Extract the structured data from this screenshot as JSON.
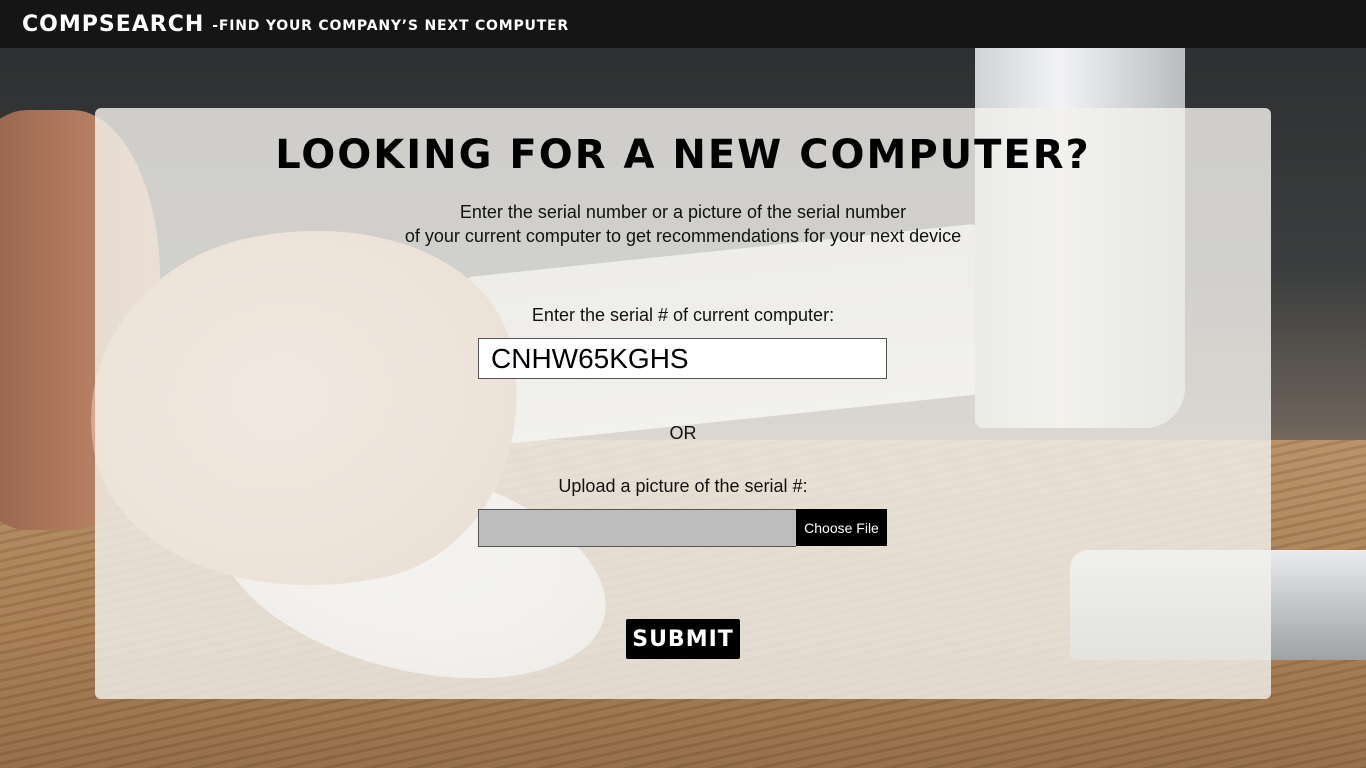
{
  "header": {
    "brand": "COMPSEARCH",
    "tagline": "-FIND YOUR COMPANY’S NEXT COMPUTER"
  },
  "main": {
    "headline": "LOOKING FOR A NEW COMPUTER?",
    "intro_line1": "Enter the serial number or a picture of the serial number",
    "intro_line2": "of your current computer to get recommendations for your next device",
    "serial_label": "Enter the serial # of current computer:",
    "serial_value": "CNHW65KGHS",
    "or_text": "OR",
    "upload_label": "Upload a picture of the serial #:",
    "choose_file_label": "Choose File",
    "submit_label": "SUBMIT"
  }
}
